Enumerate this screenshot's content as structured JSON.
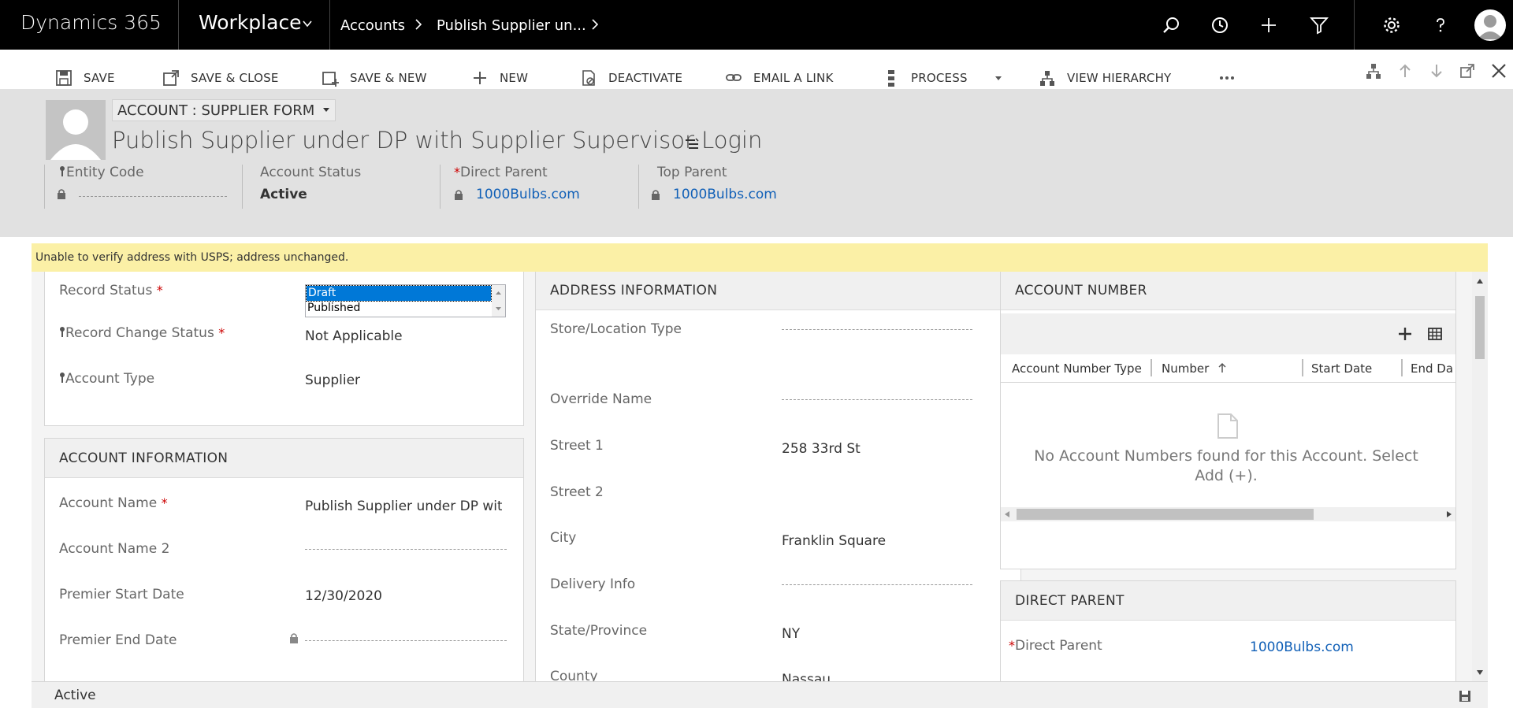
{
  "app": {
    "brand": "Dynamics 365",
    "area": "Workplace"
  },
  "breadcrumb": {
    "entity": "Accounts",
    "record": "Publish Supplier un..."
  },
  "toolbar": {
    "save": "SAVE",
    "save_close": "SAVE & CLOSE",
    "save_new": "SAVE & NEW",
    "new": "NEW",
    "deactivate": "DEACTIVATE",
    "email_link": "EMAIL A LINK",
    "process": "PROCESS",
    "view_hierarchy": "VIEW HIERARCHY"
  },
  "header": {
    "form_name": "ACCOUNT : SUPPLIER FORM",
    "title": "Publish Supplier under DP with Supplier Supervisor Login",
    "fields": [
      {
        "label": "Entity Code",
        "value": ""
      },
      {
        "label": "Account Status",
        "value": "Active"
      },
      {
        "label": "Direct Parent",
        "value": "1000Bulbs.com"
      },
      {
        "label": "Top Parent",
        "value": "1000Bulbs.com"
      }
    ]
  },
  "notification": "Unable to verify address with USPS; address unchanged.",
  "general": {
    "record_status_label": "Record Status",
    "record_status_options": [
      "Draft",
      "Published"
    ],
    "record_change_status_label": "Record Change Status",
    "record_change_status_value": "Not Applicable",
    "account_type_label": "Account Type",
    "account_type_value": "Supplier"
  },
  "account_info": {
    "heading": "ACCOUNT INFORMATION",
    "account_name_label": "Account Name",
    "account_name_value": "Publish Supplier under DP with",
    "account_name2_label": "Account Name 2",
    "premier_start_label": "Premier Start Date",
    "premier_start_value": "12/30/2020",
    "premier_end_label": "Premier End Date"
  },
  "address": {
    "heading": "ADDRESS INFORMATION",
    "store_type_label": "Store/Location Type",
    "override_name_label": "Override Name",
    "street1_label": "Street 1",
    "street1_value": "258 33rd St",
    "street2_label": "Street 2",
    "city_label": "City",
    "city_value": "Franklin Square",
    "delivery_info_label": "Delivery Info",
    "state_label": "State/Province",
    "state_value": "NY",
    "county_label": "County",
    "county_value": "Nassau"
  },
  "account_number": {
    "heading": "ACCOUNT NUMBER",
    "columns": [
      "Account Number Type",
      "Number",
      "Start Date",
      "End Da"
    ],
    "empty_message": "No Account Numbers found for this Account. Select Add (+)."
  },
  "direct_parent": {
    "heading": "DIRECT PARENT",
    "label": "Direct Parent",
    "value": "1000Bulbs.com"
  },
  "footer": {
    "status": "Active"
  },
  "colors": {
    "nav_bg": "#000000",
    "link": "#1160b7",
    "notification_bg": "#fbf0a6",
    "header_bg": "#e1e1e1",
    "required": "#cc0000"
  }
}
